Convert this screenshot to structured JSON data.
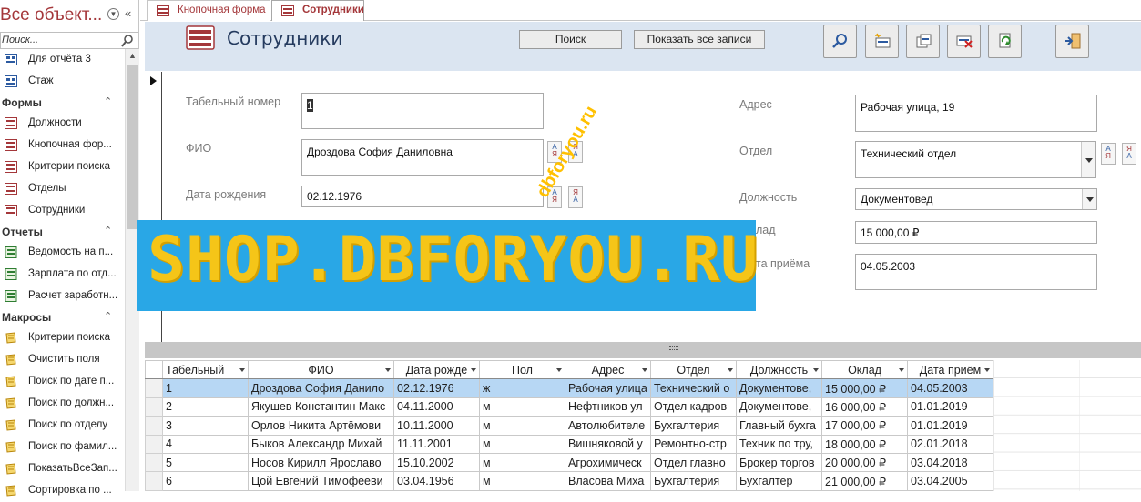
{
  "nav": {
    "title": "Все объект...",
    "search_placeholder": "Поиск...",
    "items_top": [
      {
        "label": "Для отчёта 3",
        "icon": "query-icon"
      },
      {
        "label": "Стаж",
        "icon": "query-icon"
      }
    ],
    "groups": [
      {
        "label": "Формы",
        "items": [
          {
            "label": "Должности",
            "icon": "form-icon"
          },
          {
            "label": "Кнопочная фор...",
            "icon": "form-icon"
          },
          {
            "label": "Критерии поиска",
            "icon": "form-icon"
          },
          {
            "label": "Отделы",
            "icon": "form-icon"
          },
          {
            "label": "Сотрудники",
            "icon": "form-icon"
          }
        ]
      },
      {
        "label": "Отчеты",
        "items": [
          {
            "label": "Ведомость на п...",
            "icon": "report-icon"
          },
          {
            "label": "Зарплата по отд...",
            "icon": "report-icon"
          },
          {
            "label": "Расчет заработн...",
            "icon": "report-icon"
          }
        ]
      },
      {
        "label": "Макросы",
        "items": [
          {
            "label": "Критерии поиска",
            "icon": "macro-icon"
          },
          {
            "label": "Очистить поля",
            "icon": "macro-icon"
          },
          {
            "label": "Поиск по дате п...",
            "icon": "macro-icon"
          },
          {
            "label": "Поиск по должн...",
            "icon": "macro-icon"
          },
          {
            "label": "Поиск по отделу",
            "icon": "macro-icon"
          },
          {
            "label": "Поиск по фамил...",
            "icon": "macro-icon"
          },
          {
            "label": "ПоказатьВсеЗап...",
            "icon": "macro-icon"
          },
          {
            "label": "Сортировка по ...",
            "icon": "macro-icon"
          }
        ]
      }
    ]
  },
  "tabs": [
    {
      "label": "Кнопочная форма",
      "active": false
    },
    {
      "label": "Сотрудники",
      "active": true
    }
  ],
  "form": {
    "title": "Сотрудники",
    "search_button": "Поиск",
    "show_all_button": "Показать все записи",
    "toolbar_icons": [
      "magnifier-icon",
      "new-record-icon",
      "copy-record-icon",
      "delete-record-icon",
      "refresh-icon",
      "exit-icon"
    ],
    "fields": {
      "tab_number": {
        "label": "Табельный номер",
        "value": "1"
      },
      "fio": {
        "label": "ФИО",
        "value": "Дроздова София Даниловна"
      },
      "birth_date": {
        "label": "Дата рождения",
        "value": "02.12.1976"
      },
      "address": {
        "label": "Адрес",
        "value": "Рабочая улица, 19"
      },
      "department": {
        "label": "Отдел",
        "value": "Технический отдел"
      },
      "position": {
        "label": "Должность",
        "value": "Документовед"
      },
      "salary": {
        "label": "лад",
        "value": "15 000,00 ₽"
      },
      "hire_date": {
        "label": "та приёма",
        "value": "04.05.2003"
      }
    }
  },
  "datasheet": {
    "columns": [
      "Табельный",
      "ФИО",
      "Дата рожде",
      "Пол",
      "Адрес",
      "Отдел",
      "Должность",
      "Оклад",
      "Дата приём"
    ],
    "rows": [
      [
        "1",
        "Дроздова София Данило",
        "02.12.1976",
        "ж",
        "Рабочая улица",
        "Технический о",
        "Документове,",
        "15 000,00 ₽",
        "04.05.2003"
      ],
      [
        "2",
        "Якушев Константин Макс",
        "04.11.2000",
        "м",
        "Нефтников ул",
        "Отдел кадров",
        "Документове,",
        "16 000,00 ₽",
        "01.01.2019"
      ],
      [
        "3",
        "Орлов Никита Артёмови",
        "10.11.2000",
        "м",
        "Автолюбителе",
        "Бухгалтерия",
        "Главный бухга",
        "17 000,00 ₽",
        "01.01.2019"
      ],
      [
        "4",
        "Быков Александр Михай",
        "11.11.2001",
        "м",
        "Вишняковой у",
        "Ремонтно-стр",
        "Техник по тру,",
        "18 000,00 ₽",
        "02.01.2018"
      ],
      [
        "5",
        "Носов Кирилл Ярославо",
        "15.10.2002",
        "м",
        "Агрохимическ",
        "Отдел главно",
        "Брокер торгов",
        "20 000,00 ₽",
        "03.04.2018"
      ],
      [
        "6",
        "Цой Евгений Тимофееви",
        "03.04.1956",
        "м",
        "Власова Миха",
        "Бухгалтерия",
        "Бухгалтер",
        "21 000,00 ₽",
        "03.04.2005"
      ]
    ]
  },
  "watermark": {
    "text": "SHOP.DBFORYOU.RU",
    "diagonal_text": "dbforyou.ru"
  },
  "colors": {
    "nav_title": "#a4373a",
    "form_header": "#dbe5f1",
    "current_row": "#b7d7f4",
    "watermark_bg": "#29a7e6",
    "watermark_text": "#f5c518"
  }
}
